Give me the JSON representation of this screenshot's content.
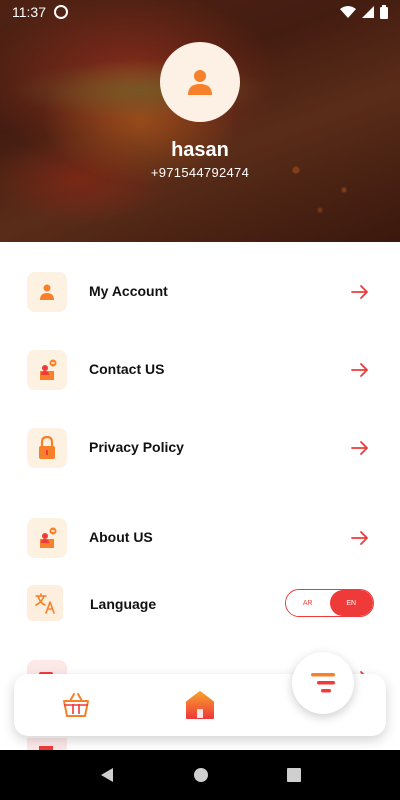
{
  "status_bar": {
    "time": "11:37"
  },
  "profile": {
    "name": "hasan",
    "phone": "+971544792474"
  },
  "menu": [
    {
      "label": "My Account",
      "icon": "user-icon"
    },
    {
      "label": "Contact US",
      "icon": "contact-icon"
    },
    {
      "label": "Privacy Policy",
      "icon": "lock-icon"
    },
    {
      "label": "About US",
      "icon": "about-icon"
    }
  ],
  "language": {
    "label": "Language",
    "options": [
      "AR",
      "EN"
    ],
    "selected": "EN"
  },
  "colors": {
    "accent": "#ef3a3a",
    "orange": "#f7812b",
    "icon_bg": "#fdf1e1"
  }
}
